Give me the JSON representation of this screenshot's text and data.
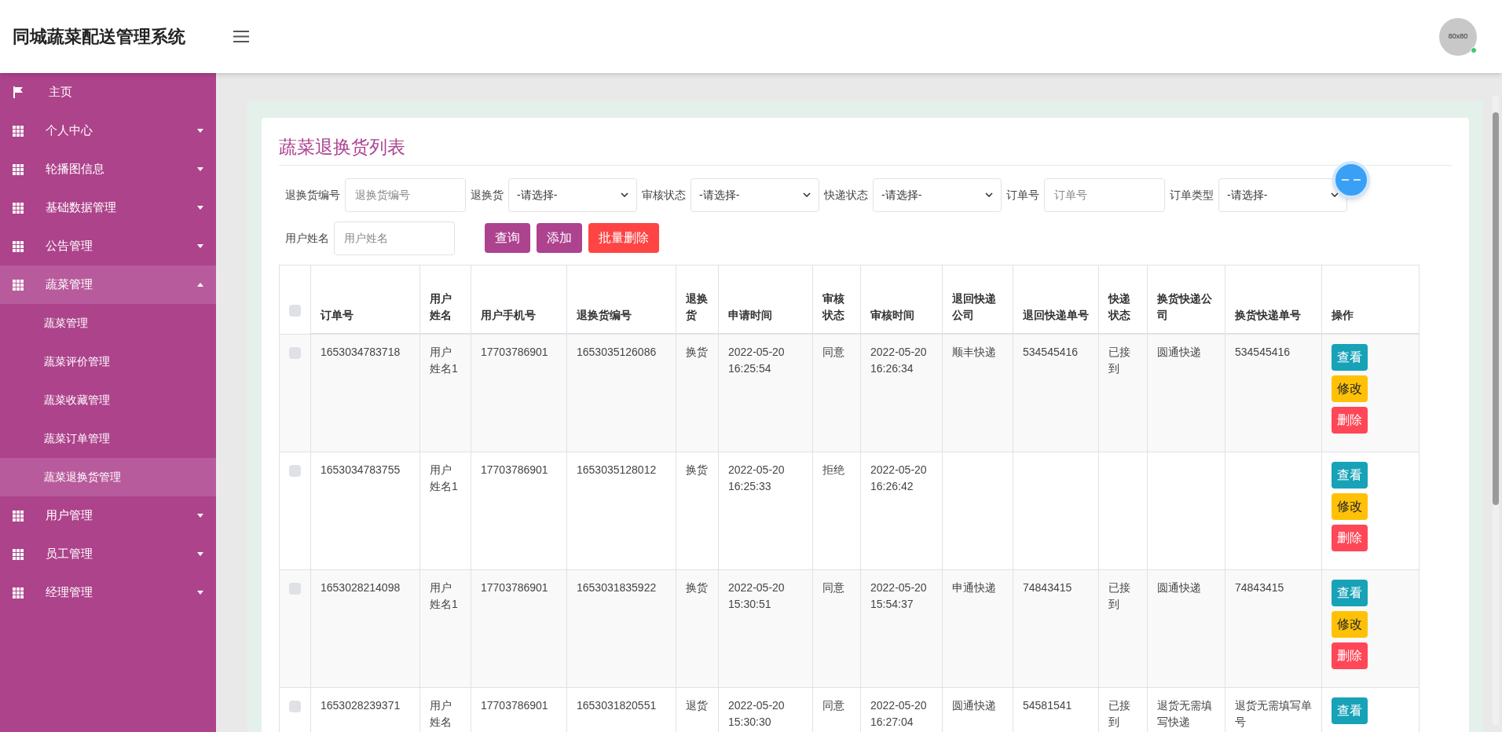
{
  "header": {
    "title": "同城蔬菜配送管理系统",
    "avatar_text": "80x80",
    "online": true
  },
  "sidebar": {
    "items": [
      {
        "label": "主页",
        "kind": "link",
        "selected": false
      },
      {
        "label": "个人中心",
        "kind": "menu",
        "expanded": false,
        "selected": false
      },
      {
        "label": "轮播图信息",
        "kind": "menu",
        "expanded": false,
        "selected": false
      },
      {
        "label": "基础数据管理",
        "kind": "menu",
        "expanded": false,
        "selected": false
      },
      {
        "label": "公告管理",
        "kind": "menu",
        "expanded": false,
        "selected": false
      },
      {
        "label": "蔬菜管理",
        "kind": "menu",
        "expanded": true,
        "selected": true,
        "children": [
          {
            "label": "蔬菜管理",
            "selected": false
          },
          {
            "label": "蔬菜评价管理",
            "selected": false
          },
          {
            "label": "蔬菜收藏管理",
            "selected": false
          },
          {
            "label": "蔬菜订单管理",
            "selected": false
          },
          {
            "label": "蔬菜退换货管理",
            "selected": true
          }
        ]
      },
      {
        "label": "用户管理",
        "kind": "menu",
        "expanded": false,
        "selected": false
      },
      {
        "label": "员工管理",
        "kind": "menu",
        "expanded": false,
        "selected": false
      },
      {
        "label": "经理管理",
        "kind": "menu",
        "expanded": false,
        "selected": false
      }
    ]
  },
  "page_title": "蔬菜退换货列表",
  "filters": [
    {
      "label": "退换货编号",
      "kind": "input",
      "placeholder": "退换货编号"
    },
    {
      "label": "退换货",
      "kind": "select",
      "value": "-请选择-"
    },
    {
      "label": "审核状态",
      "kind": "select",
      "value": "-请选择-"
    },
    {
      "label": "快递状态",
      "kind": "select",
      "value": "-请选择-"
    },
    {
      "label": "订单号",
      "kind": "input",
      "placeholder": "订单号"
    },
    {
      "label": "订单类型",
      "kind": "select",
      "value": "-请选择-"
    },
    {
      "label": "用户姓名",
      "kind": "input",
      "placeholder": "用户姓名"
    }
  ],
  "actions": [
    {
      "label": "查询",
      "kind": "primary"
    },
    {
      "label": "添加",
      "kind": "primary"
    },
    {
      "label": "批量删除",
      "kind": "danger"
    }
  ],
  "table": {
    "select_all_checked": false,
    "columns": [
      "订单号",
      "用户姓名",
      "用户手机号",
      "退换货编号",
      "退换货",
      "申请时间",
      "审核状态",
      "审核时间",
      "退回快递公司",
      "退回快递单号",
      "快递状态",
      "换货快递公司",
      "换货快递单号",
      "操作"
    ],
    "rows": [
      {
        "checked": false,
        "cells": [
          "1653034783718",
          "用户姓名1",
          "17703786901",
          "1653035126086",
          "换货",
          "2022-05-20 16:25:54",
          "同意",
          "2022-05-20 16:26:34",
          "顺丰快递",
          "534545416",
          "已接到",
          "圆通快递",
          "534545416"
        ],
        "buttons": [
          {
            "label": "查看",
            "kind": "view"
          },
          {
            "label": "修改",
            "kind": "edit"
          },
          {
            "label": "删除",
            "kind": "delete"
          }
        ]
      },
      {
        "checked": false,
        "cells": [
          "1653034783755",
          "用户姓名1",
          "17703786901",
          "1653035128012",
          "换货",
          "2022-05-20 16:25:33",
          "拒绝",
          "2022-05-20 16:26:42",
          "",
          "",
          "",
          "",
          ""
        ],
        "buttons": [
          {
            "label": "查看",
            "kind": "view"
          },
          {
            "label": "修改",
            "kind": "edit"
          },
          {
            "label": "删除",
            "kind": "delete"
          }
        ]
      },
      {
        "checked": false,
        "cells": [
          "1653028214098",
          "用户姓名1",
          "17703786901",
          "1653031835922",
          "换货",
          "2022-05-20 15:30:51",
          "同意",
          "2022-05-20 15:54:37",
          "申通快递",
          "74843415",
          "已接到",
          "圆通快递",
          "74843415"
        ],
        "buttons": [
          {
            "label": "查看",
            "kind": "view"
          },
          {
            "label": "修改",
            "kind": "edit"
          },
          {
            "label": "删除",
            "kind": "delete"
          }
        ]
      },
      {
        "checked": false,
        "cells": [
          "1653028239371",
          "用户姓名",
          "17703786901",
          "1653031820551",
          "退货",
          "2022-05-20 15:30:30",
          "同意",
          "2022-05-20 16:27:04",
          "圆通快递",
          "54581541",
          "已接到",
          "退货无需填写快递",
          "退货无需填写单号"
        ],
        "buttons": [
          {
            "label": "查看",
            "kind": "view"
          }
        ]
      }
    ]
  }
}
